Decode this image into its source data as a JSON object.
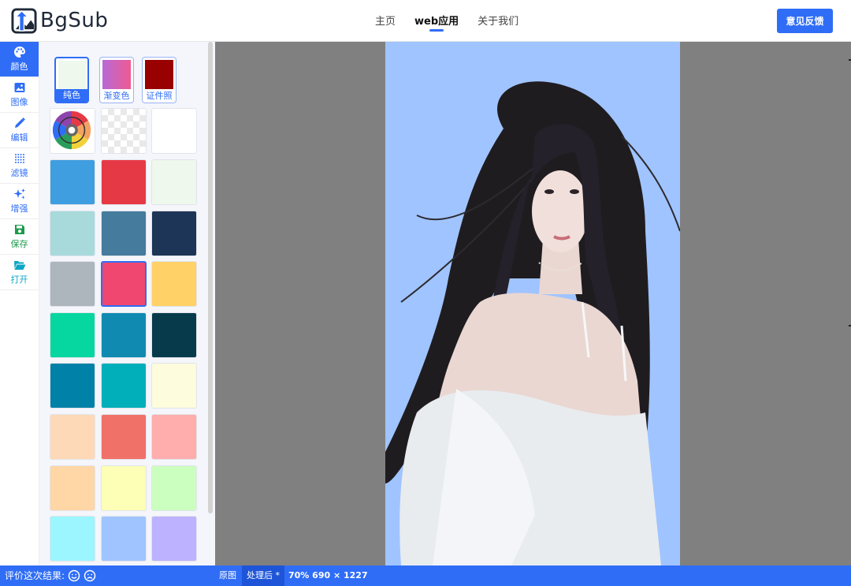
{
  "header": {
    "logo_text": "BgSub",
    "nav": [
      {
        "label": "主页",
        "active": false
      },
      {
        "label": "web应用",
        "active": true
      },
      {
        "label": "关于我们",
        "active": false
      }
    ],
    "feedback_label": "意见反馈"
  },
  "rail": {
    "items": [
      {
        "label": "颜色",
        "icon": "palette-icon",
        "active": true
      },
      {
        "label": "图像",
        "icon": "image-icon",
        "active": false
      },
      {
        "label": "编辑",
        "icon": "pencil-icon",
        "active": false
      },
      {
        "label": "滤镜",
        "icon": "dots-grid-icon",
        "active": false
      },
      {
        "label": "增强",
        "icon": "sparkles-icon",
        "active": false
      },
      {
        "label": "保存",
        "icon": "save-icon",
        "active": false
      },
      {
        "label": "打开",
        "icon": "folder-open-icon",
        "active": false
      }
    ]
  },
  "panel": {
    "modes": [
      {
        "label": "纯色",
        "active": true
      },
      {
        "label": "渐变色",
        "active": false
      },
      {
        "label": "证件照",
        "active": false
      }
    ],
    "special_swatches": [
      "color-wheel",
      "transparent",
      "white"
    ],
    "swatches": [
      "#3f9ee0",
      "#e63946",
      "#eef8ec",
      "#a8dadc",
      "#457b9d",
      "#1d3557",
      "#adb5bd",
      "#ef476f",
      "#ffd166",
      "#06d6a0",
      "#118ab2",
      "#073b4c",
      "#0081a7",
      "#00afb9",
      "#fdfcdc",
      "#fed9b7",
      "#f07167",
      "#ffadad",
      "#ffd6a5",
      "#fdffb6",
      "#caffbf",
      "#9bf6ff",
      "#a0c4ff",
      "#bdb2ff"
    ],
    "selected_swatch": "#ef476f"
  },
  "canvas": {
    "background_color": "#a0c4ff"
  },
  "status": {
    "rate_label": "评价这次结果:",
    "original_label": "原图",
    "processed_label": "处理后 *",
    "info": "70% 690 × 1227"
  },
  "colors": {
    "accent": "#2f6df6"
  }
}
